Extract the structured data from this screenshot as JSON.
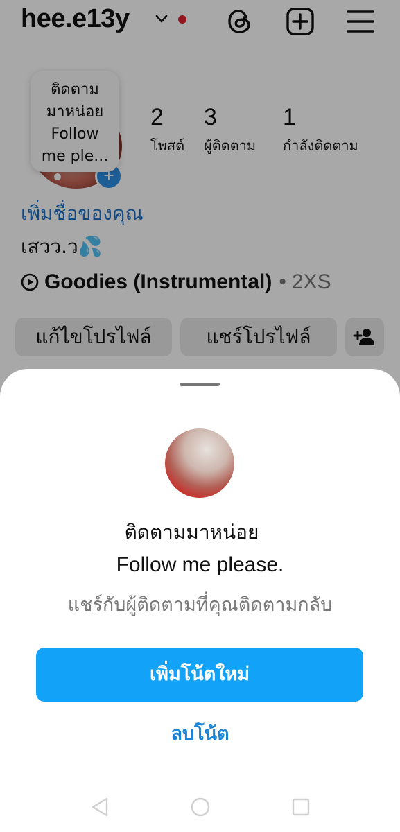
{
  "header": {
    "username": "hee.e13y",
    "icons": [
      "chevron-down-icon",
      "threads-icon",
      "add-post-icon",
      "menu-icon"
    ],
    "notification_dot_color": "#e02030"
  },
  "profile": {
    "note_bubble_lines": [
      "ติดตาม",
      "มาหน่อย",
      "Follow",
      "me ple..."
    ],
    "stats": [
      {
        "value": "2",
        "label": "โพสต์"
      },
      {
        "value": "3",
        "label": "ผู้ติดตาม"
      },
      {
        "value": "1",
        "label": "กำลังติดตาม"
      }
    ],
    "add_name_link": "เพิ่มชื่อของคุณ",
    "bio": "เสวว.ว",
    "bio_emoji": "💦",
    "music": {
      "title": "Goodies (Instrumental)",
      "separator": "•",
      "artist": "2XS"
    },
    "buttons": {
      "edit_profile": "แก้ไขโปรไฟล์",
      "share_profile": "แชร์โปรไฟล์"
    }
  },
  "sheet": {
    "note_line1": "ติดตามมาหน่อย",
    "note_line2": "Follow me please.",
    "caption": "แชร์กับผู้ติดตามที่คุณติดตามกลับ",
    "new_note_button": "เพิ่มโน้ตใหม่",
    "delete_note": "ลบโน้ต",
    "accent_color": "#12a2f8"
  },
  "nav": {
    "icons": [
      "back-nav-icon",
      "home-nav-icon",
      "recents-nav-icon"
    ]
  }
}
